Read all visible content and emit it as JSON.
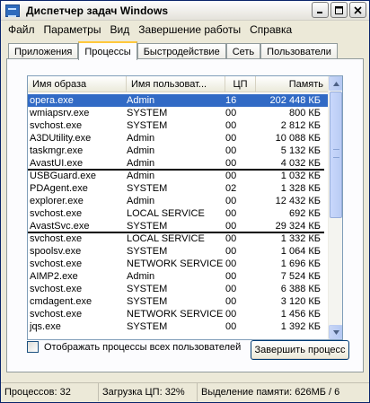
{
  "window": {
    "title": "Диспетчер задач Windows",
    "buttons": [
      "minimize",
      "maximize",
      "close"
    ]
  },
  "menu": [
    "Файл",
    "Параметры",
    "Вид",
    "Завершение работы",
    "Справка"
  ],
  "tabs": [
    {
      "label": "Приложения",
      "active": false
    },
    {
      "label": "Процессы",
      "active": true
    },
    {
      "label": "Быстродействие",
      "active": false
    },
    {
      "label": "Сеть",
      "active": false
    },
    {
      "label": "Пользователи",
      "active": false
    }
  ],
  "table": {
    "columns": [
      "Имя образа",
      "Имя пользоват...",
      "ЦП",
      "Память"
    ],
    "rows": [
      {
        "name": "opera.exe",
        "user": "Admin",
        "cpu": "16",
        "mem": "202 448 КБ",
        "selected": true
      },
      {
        "name": "wmiapsrv.exe",
        "user": "SYSTEM",
        "cpu": "00",
        "mem": "800 КБ"
      },
      {
        "name": "svchost.exe",
        "user": "SYSTEM",
        "cpu": "00",
        "mem": "2 812 КБ"
      },
      {
        "name": "A3DUtility.exe",
        "user": "Admin",
        "cpu": "00",
        "mem": "10 088 КБ"
      },
      {
        "name": "taskmgr.exe",
        "user": "Admin",
        "cpu": "00",
        "mem": "5 132 КБ"
      },
      {
        "name": "AvastUI.exe",
        "user": "Admin",
        "cpu": "00",
        "mem": "4 032 КБ",
        "underline": true
      },
      {
        "name": "USBGuard.exe",
        "user": "Admin",
        "cpu": "00",
        "mem": "1 032 КБ"
      },
      {
        "name": "PDAgent.exe",
        "user": "SYSTEM",
        "cpu": "02",
        "mem": "1 328 КБ"
      },
      {
        "name": "explorer.exe",
        "user": "Admin",
        "cpu": "00",
        "mem": "12 432 КБ"
      },
      {
        "name": "svchost.exe",
        "user": "LOCAL SERVICE",
        "cpu": "00",
        "mem": "692 КБ"
      },
      {
        "name": "AvastSvc.exe",
        "user": "SYSTEM",
        "cpu": "00",
        "mem": "29 324 КБ",
        "underline": true
      },
      {
        "name": "svchost.exe",
        "user": "LOCAL SERVICE",
        "cpu": "00",
        "mem": "1 332 КБ"
      },
      {
        "name": "spoolsv.exe",
        "user": "SYSTEM",
        "cpu": "00",
        "mem": "1 064 КБ"
      },
      {
        "name": "svchost.exe",
        "user": "NETWORK SERVICE",
        "cpu": "00",
        "mem": "1 696 КБ"
      },
      {
        "name": "AIMP2.exe",
        "user": "Admin",
        "cpu": "00",
        "mem": "7 524 КБ"
      },
      {
        "name": "svchost.exe",
        "user": "SYSTEM",
        "cpu": "00",
        "mem": "6 388 КБ"
      },
      {
        "name": "cmdagent.exe",
        "user": "SYSTEM",
        "cpu": "00",
        "mem": "3 120 КБ"
      },
      {
        "name": "svchost.exe",
        "user": "NETWORK SERVICE",
        "cpu": "00",
        "mem": "1 456 КБ"
      },
      {
        "name": "jqs.exe",
        "user": "SYSTEM",
        "cpu": "00",
        "mem": "1 392 КБ"
      }
    ]
  },
  "show_all_users_label": "Отображать процессы всех пользователей",
  "show_all_users_checked": false,
  "end_process_label": "Завершить процесс",
  "status": {
    "processes": "Процессов: 32",
    "cpu": "Загрузка ЦП: 32%",
    "memory": "Выделение памяти: 626МБ / 6"
  }
}
